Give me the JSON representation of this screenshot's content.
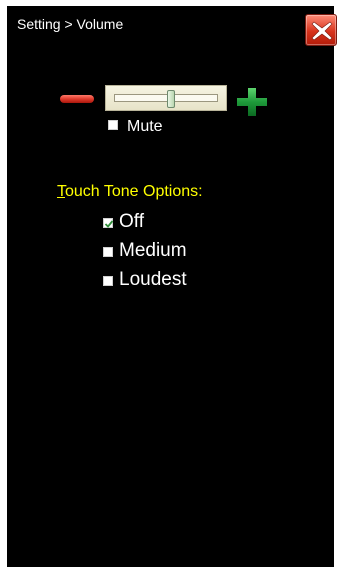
{
  "header": {
    "breadcrumb": "Setting > Volume",
    "close_icon": "close-x-icon"
  },
  "volume": {
    "decrease_icon": "minus-icon",
    "increase_icon": "plus-icon",
    "level_fraction": 0.55,
    "mute_label": "Mute",
    "mute_checked": false
  },
  "touch_tone": {
    "heading_first": "T",
    "heading_rest": "ouch Tone Options:",
    "options": [
      {
        "label": "Off",
        "checked": true
      },
      {
        "label": "Medium",
        "checked": false
      },
      {
        "label": "Loudest",
        "checked": false
      }
    ]
  },
  "colors": {
    "background": "#000000",
    "text": "#ffffff",
    "heading": "#ffff00",
    "minus": "#e03a2c",
    "plus": "#1e9a3a",
    "close": "#d7331c"
  }
}
